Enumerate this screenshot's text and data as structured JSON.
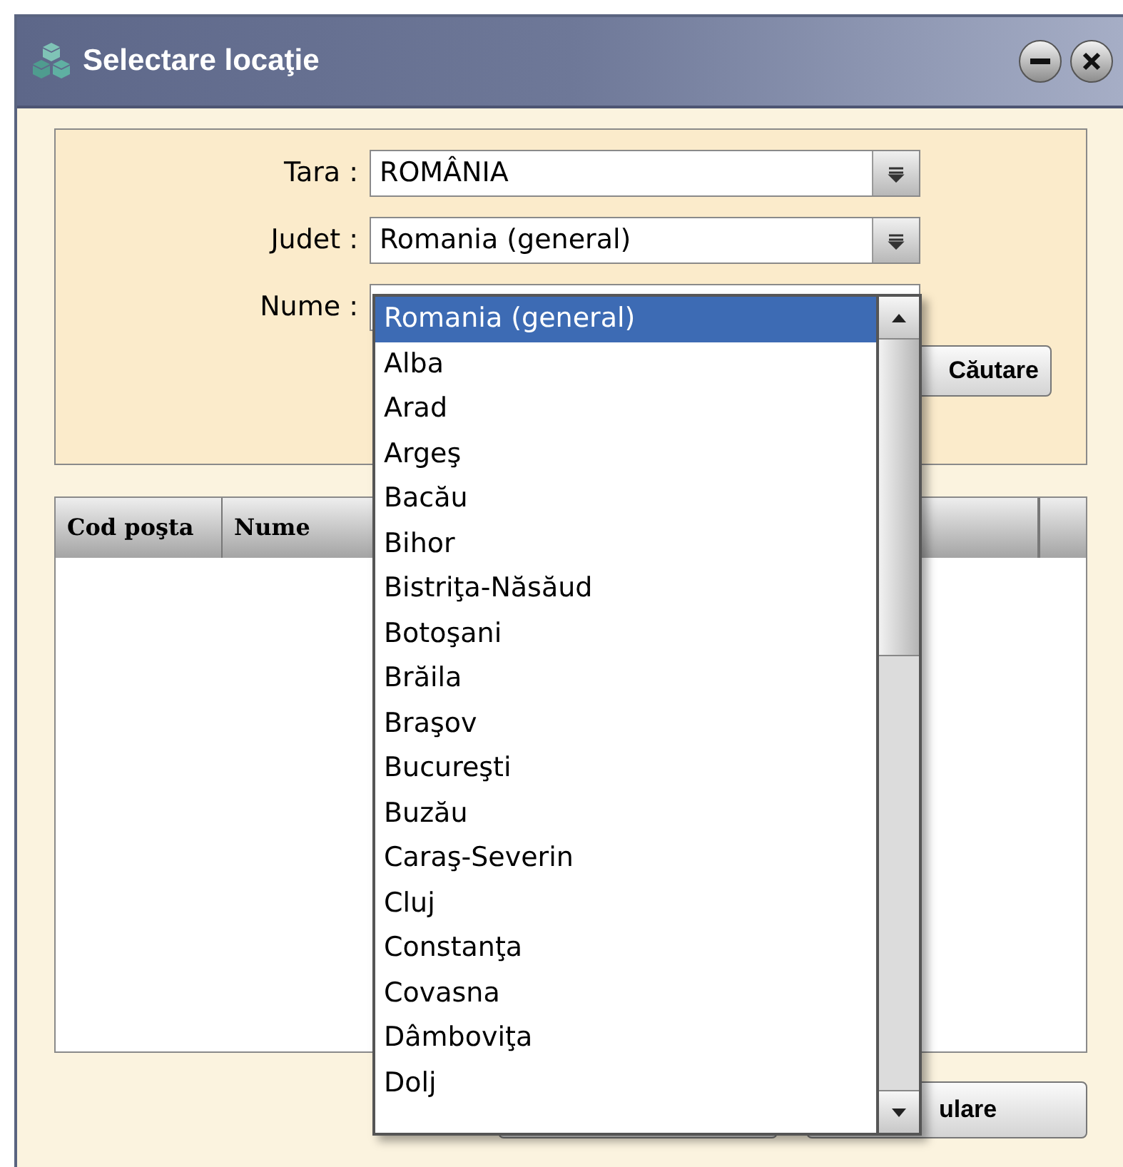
{
  "window": {
    "title": "Selectare locaţie"
  },
  "form": {
    "fields": [
      {
        "label": "Tara :",
        "kind": "combo",
        "value": "ROMÂNIA"
      },
      {
        "label": "Judet :",
        "kind": "combo",
        "value": "Romania (general)"
      },
      {
        "label": "Nume :",
        "kind": "text"
      }
    ],
    "search_button": "Căutare"
  },
  "table": {
    "columns": [
      "Cod poşta",
      "Nume"
    ]
  },
  "buttons": [
    "ulare"
  ],
  "dropdown": {
    "items": [
      {
        "label": "Romania (general)",
        "selected": true
      },
      {
        "label": "Alba",
        "selected": false
      },
      {
        "label": "Arad",
        "selected": false
      },
      {
        "label": "Argeş",
        "selected": false
      },
      {
        "label": "Bacău",
        "selected": false
      },
      {
        "label": "Bihor",
        "selected": false
      },
      {
        "label": "Bistriţa-Năsăud",
        "selected": false
      },
      {
        "label": "Botoşani",
        "selected": false
      },
      {
        "label": "Brăila",
        "selected": false
      },
      {
        "label": "Braşov",
        "selected": false
      },
      {
        "label": "Bucureşti",
        "selected": false
      },
      {
        "label": "Buzău",
        "selected": false
      },
      {
        "label": "Caraş-Severin",
        "selected": false
      },
      {
        "label": "Cluj",
        "selected": false
      },
      {
        "label": "Constanţa",
        "selected": false
      },
      {
        "label": "Covasna",
        "selected": false
      },
      {
        "label": "Dâmboviţa",
        "selected": false
      },
      {
        "label": "Dolj",
        "selected": false
      }
    ]
  }
}
